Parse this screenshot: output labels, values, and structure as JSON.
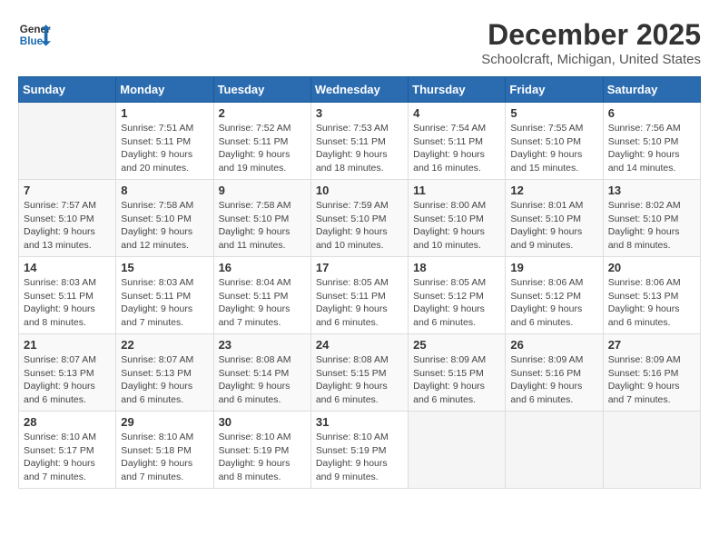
{
  "header": {
    "logo_line1": "General",
    "logo_line2": "Blue",
    "title": "December 2025",
    "location": "Schoolcraft, Michigan, United States"
  },
  "days_of_week": [
    "Sunday",
    "Monday",
    "Tuesday",
    "Wednesday",
    "Thursday",
    "Friday",
    "Saturday"
  ],
  "weeks": [
    [
      {
        "day": "",
        "info": ""
      },
      {
        "day": "1",
        "info": "Sunrise: 7:51 AM\nSunset: 5:11 PM\nDaylight: 9 hours\nand 20 minutes."
      },
      {
        "day": "2",
        "info": "Sunrise: 7:52 AM\nSunset: 5:11 PM\nDaylight: 9 hours\nand 19 minutes."
      },
      {
        "day": "3",
        "info": "Sunrise: 7:53 AM\nSunset: 5:11 PM\nDaylight: 9 hours\nand 18 minutes."
      },
      {
        "day": "4",
        "info": "Sunrise: 7:54 AM\nSunset: 5:11 PM\nDaylight: 9 hours\nand 16 minutes."
      },
      {
        "day": "5",
        "info": "Sunrise: 7:55 AM\nSunset: 5:10 PM\nDaylight: 9 hours\nand 15 minutes."
      },
      {
        "day": "6",
        "info": "Sunrise: 7:56 AM\nSunset: 5:10 PM\nDaylight: 9 hours\nand 14 minutes."
      }
    ],
    [
      {
        "day": "7",
        "info": "Sunrise: 7:57 AM\nSunset: 5:10 PM\nDaylight: 9 hours\nand 13 minutes."
      },
      {
        "day": "8",
        "info": "Sunrise: 7:58 AM\nSunset: 5:10 PM\nDaylight: 9 hours\nand 12 minutes."
      },
      {
        "day": "9",
        "info": "Sunrise: 7:58 AM\nSunset: 5:10 PM\nDaylight: 9 hours\nand 11 minutes."
      },
      {
        "day": "10",
        "info": "Sunrise: 7:59 AM\nSunset: 5:10 PM\nDaylight: 9 hours\nand 10 minutes."
      },
      {
        "day": "11",
        "info": "Sunrise: 8:00 AM\nSunset: 5:10 PM\nDaylight: 9 hours\nand 10 minutes."
      },
      {
        "day": "12",
        "info": "Sunrise: 8:01 AM\nSunset: 5:10 PM\nDaylight: 9 hours\nand 9 minutes."
      },
      {
        "day": "13",
        "info": "Sunrise: 8:02 AM\nSunset: 5:10 PM\nDaylight: 9 hours\nand 8 minutes."
      }
    ],
    [
      {
        "day": "14",
        "info": "Sunrise: 8:03 AM\nSunset: 5:11 PM\nDaylight: 9 hours\nand 8 minutes."
      },
      {
        "day": "15",
        "info": "Sunrise: 8:03 AM\nSunset: 5:11 PM\nDaylight: 9 hours\nand 7 minutes."
      },
      {
        "day": "16",
        "info": "Sunrise: 8:04 AM\nSunset: 5:11 PM\nDaylight: 9 hours\nand 7 minutes."
      },
      {
        "day": "17",
        "info": "Sunrise: 8:05 AM\nSunset: 5:11 PM\nDaylight: 9 hours\nand 6 minutes."
      },
      {
        "day": "18",
        "info": "Sunrise: 8:05 AM\nSunset: 5:12 PM\nDaylight: 9 hours\nand 6 minutes."
      },
      {
        "day": "19",
        "info": "Sunrise: 8:06 AM\nSunset: 5:12 PM\nDaylight: 9 hours\nand 6 minutes."
      },
      {
        "day": "20",
        "info": "Sunrise: 8:06 AM\nSunset: 5:13 PM\nDaylight: 9 hours\nand 6 minutes."
      }
    ],
    [
      {
        "day": "21",
        "info": "Sunrise: 8:07 AM\nSunset: 5:13 PM\nDaylight: 9 hours\nand 6 minutes."
      },
      {
        "day": "22",
        "info": "Sunrise: 8:07 AM\nSunset: 5:13 PM\nDaylight: 9 hours\nand 6 minutes."
      },
      {
        "day": "23",
        "info": "Sunrise: 8:08 AM\nSunset: 5:14 PM\nDaylight: 9 hours\nand 6 minutes."
      },
      {
        "day": "24",
        "info": "Sunrise: 8:08 AM\nSunset: 5:15 PM\nDaylight: 9 hours\nand 6 minutes."
      },
      {
        "day": "25",
        "info": "Sunrise: 8:09 AM\nSunset: 5:15 PM\nDaylight: 9 hours\nand 6 minutes."
      },
      {
        "day": "26",
        "info": "Sunrise: 8:09 AM\nSunset: 5:16 PM\nDaylight: 9 hours\nand 6 minutes."
      },
      {
        "day": "27",
        "info": "Sunrise: 8:09 AM\nSunset: 5:16 PM\nDaylight: 9 hours\nand 7 minutes."
      }
    ],
    [
      {
        "day": "28",
        "info": "Sunrise: 8:10 AM\nSunset: 5:17 PM\nDaylight: 9 hours\nand 7 minutes."
      },
      {
        "day": "29",
        "info": "Sunrise: 8:10 AM\nSunset: 5:18 PM\nDaylight: 9 hours\nand 7 minutes."
      },
      {
        "day": "30",
        "info": "Sunrise: 8:10 AM\nSunset: 5:19 PM\nDaylight: 9 hours\nand 8 minutes."
      },
      {
        "day": "31",
        "info": "Sunrise: 8:10 AM\nSunset: 5:19 PM\nDaylight: 9 hours\nand 9 minutes."
      },
      {
        "day": "",
        "info": ""
      },
      {
        "day": "",
        "info": ""
      },
      {
        "day": "",
        "info": ""
      }
    ]
  ]
}
